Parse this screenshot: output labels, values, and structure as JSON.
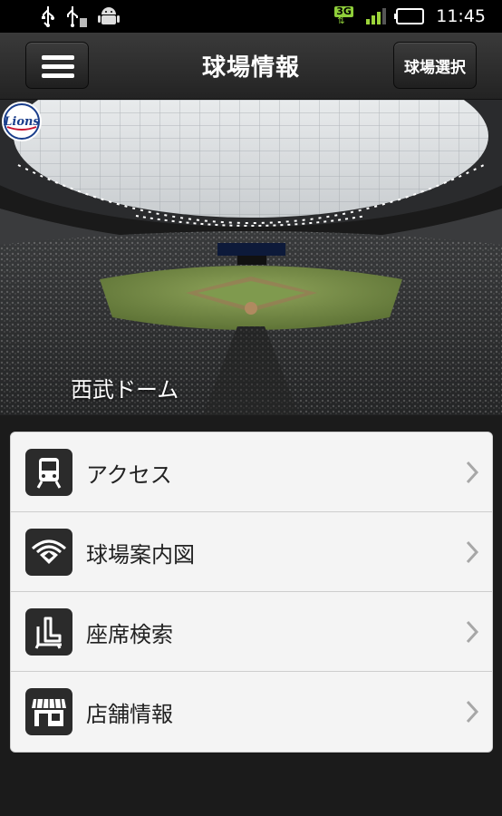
{
  "status_bar": {
    "icons": [
      "usb-icon",
      "usb-debug-icon",
      "android-icon"
    ],
    "network": "3G",
    "time": "11:45"
  },
  "header": {
    "title": "球場情報",
    "select_label": "球場選択",
    "menu_icon": "hamburger-icon"
  },
  "hero": {
    "stadium_name": "西武ドーム",
    "team_logo": "Lions"
  },
  "menu": {
    "items": [
      {
        "label": "アクセス",
        "icon": "train-icon"
      },
      {
        "label": "球場案内図",
        "icon": "stadium-map-icon"
      },
      {
        "label": "座席検索",
        "icon": "seat-icon"
      },
      {
        "label": "店舗情報",
        "icon": "shop-icon"
      }
    ]
  },
  "colors": {
    "header_bg": "#2e2e2e",
    "page_bg": "#1b1b1b",
    "list_bg": "#f4f4f4",
    "icon_tile": "#2b2b2b",
    "network_accent": "#8fcf3a"
  }
}
